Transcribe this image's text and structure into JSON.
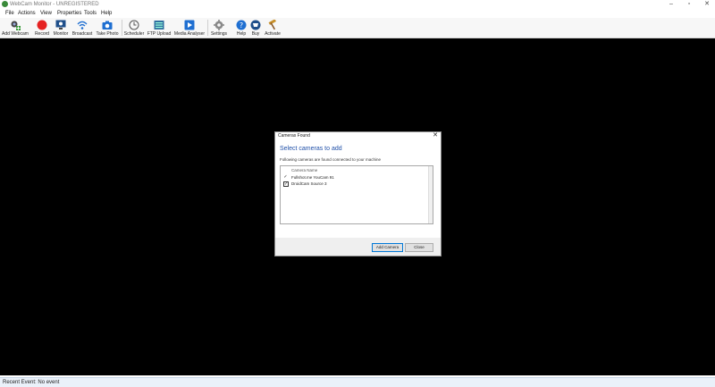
{
  "window": {
    "title": "WebCam Monitor - UNREGISTERED",
    "minimize_glyph": "–",
    "maximize_glyph": "▫",
    "close_glyph": "✕"
  },
  "menu": {
    "items": [
      "File",
      "Actions",
      "View",
      "Properties",
      "Tools",
      "Help"
    ]
  },
  "toolbar": {
    "buttons": [
      {
        "label": "Add Webcam",
        "icon": "add-webcam-icon"
      },
      {
        "label": "Record",
        "icon": "record-icon"
      },
      {
        "label": "Monitor",
        "icon": "monitor-icon"
      },
      {
        "label": "Broadcast",
        "icon": "broadcast-icon"
      },
      {
        "label": "Take Photo",
        "icon": "camera-icon"
      },
      {
        "label": "Scheduler",
        "icon": "scheduler-icon"
      },
      {
        "label": "FTP Upload",
        "icon": "ftp-upload-icon"
      },
      {
        "label": "Media Analyser",
        "icon": "media-analyser-icon"
      },
      {
        "label": "Settings",
        "icon": "settings-icon"
      },
      {
        "label": "Help",
        "icon": "help-icon"
      },
      {
        "label": "Buy",
        "icon": "buy-icon"
      },
      {
        "label": "Activate",
        "icon": "activate-icon"
      }
    ],
    "colors": {
      "record": "#e52222",
      "blue": "#1f6fd1",
      "green": "#3a9a3a"
    }
  },
  "status": {
    "text": "Recent Event: No event"
  },
  "dialog": {
    "title": "Cameras Found",
    "close_glyph": "✕",
    "heading": "Select cameras to add",
    "description": "Following cameras are found connected to your machine",
    "list_header": "Camera Name",
    "cameras": [
      {
        "name": "Fullshot.me YouCam 91",
        "checked": true
      },
      {
        "name": "DroidCam Source 3",
        "checked": true
      }
    ],
    "add_button": "Add Camera",
    "close_button": "Close",
    "heading_color": "#1f4fa8"
  }
}
